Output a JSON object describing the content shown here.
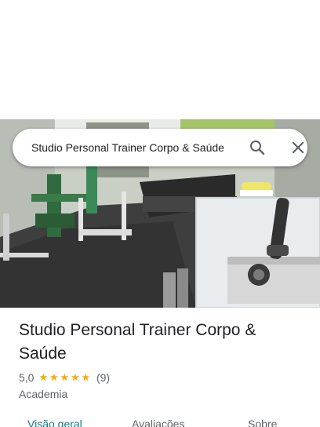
{
  "search": {
    "query": "Studio Personal Trainer Corpo & Saúde",
    "search_icon": "search-icon",
    "close_icon": "close-icon"
  },
  "place": {
    "photo_description_icon": "gym-photo",
    "title": "Studio Personal Trainer Corpo & Saúde",
    "rating_value": "5,0",
    "stars": 5,
    "review_count": "(9)",
    "category": "Academia"
  },
  "tabs": [
    {
      "label": "Visão geral",
      "active": true
    },
    {
      "label": "Avaliações",
      "active": false
    },
    {
      "label": "Sobre",
      "active": false
    }
  ],
  "colors": {
    "accent": "#137c87",
    "star": "#f9ab00",
    "secondary_text": "#5f6368"
  }
}
